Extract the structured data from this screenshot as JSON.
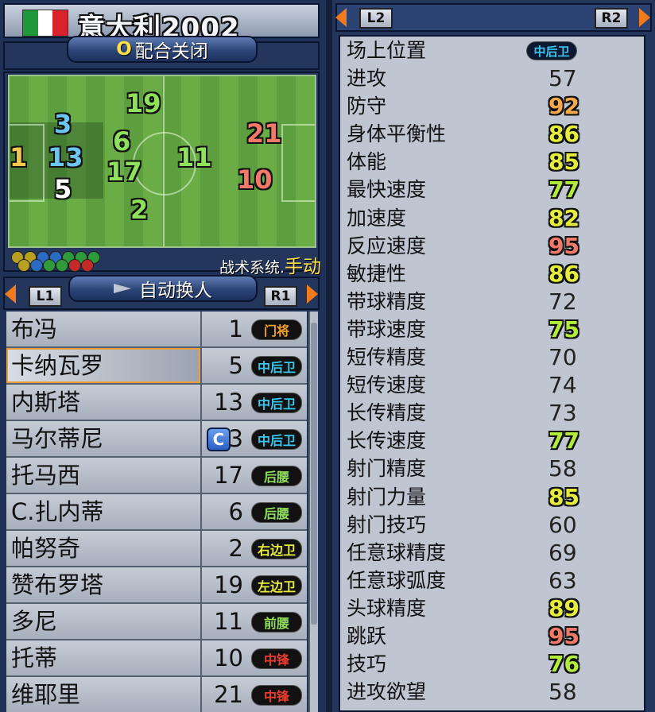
{
  "team": {
    "name": "意大利2002",
    "flag_colors": [
      "#1f9a3a",
      "#ffffff",
      "#d8232c"
    ]
  },
  "teamwork": {
    "key": "O",
    "label": "配合关闭"
  },
  "pitch": {
    "players": [
      {
        "num": "19",
        "color": "#8fe05a"
      },
      {
        "num": "3",
        "color": "#6cc6f0"
      },
      {
        "num": "21",
        "color": "#f2786a"
      },
      {
        "num": "6",
        "color": "#8fe05a"
      },
      {
        "num": "1",
        "color": "#f2c84a"
      },
      {
        "num": "13",
        "color": "#6cc6f0"
      },
      {
        "num": "11",
        "color": "#8fe05a"
      },
      {
        "num": "17",
        "color": "#8fe05a"
      },
      {
        "num": "10",
        "color": "#f2786a"
      },
      {
        "num": "5",
        "color": "#ffffff"
      },
      {
        "num": "2",
        "color": "#8fe05a"
      }
    ]
  },
  "tactics": {
    "label": "战术系统.",
    "mode": "手动"
  },
  "sub_bar": {
    "left_key": "L1",
    "label": "自动换人",
    "right_key": "R1"
  },
  "roster": [
    {
      "name": "布冯",
      "number": "1",
      "pos": "门将",
      "pos_color": "#f3a028"
    },
    {
      "name": "卡纳瓦罗",
      "number": "5",
      "pos": "中后卫",
      "pos_color": "#38c8f0"
    },
    {
      "name": "内斯塔",
      "number": "13",
      "pos": "中后卫",
      "pos_color": "#38c8f0"
    },
    {
      "name": "马尔蒂尼",
      "number": "3",
      "pos": "中后卫",
      "pos_color": "#38c8f0",
      "captain": "C"
    },
    {
      "name": "托马西",
      "number": "17",
      "pos": "后腰",
      "pos_color": "#8fe05a"
    },
    {
      "name": "C.扎内蒂",
      "number": "6",
      "pos": "后腰",
      "pos_color": "#8fe05a"
    },
    {
      "name": "帕努奇",
      "number": "2",
      "pos": "右边卫",
      "pos_color": "#e8ec3c"
    },
    {
      "name": "赞布罗塔",
      "number": "19",
      "pos": "左边卫",
      "pos_color": "#e8ec3c"
    },
    {
      "name": "多尼",
      "number": "11",
      "pos": "前腰",
      "pos_color": "#8fe05a"
    },
    {
      "name": "托蒂",
      "number": "10",
      "pos": "中锋",
      "pos_color": "#f03a2c"
    },
    {
      "name": "维耶里",
      "number": "21",
      "pos": "中锋",
      "pos_color": "#f03a2c"
    }
  ],
  "right_header": {
    "left_key": "L2",
    "right_key": "R2"
  },
  "stats": [
    {
      "label": "场上位置",
      "badge": "中后卫"
    },
    {
      "label": "进攻",
      "value": "57"
    },
    {
      "label": "防守",
      "value": "92",
      "color": "#f6a84a"
    },
    {
      "label": "身体平衡性",
      "value": "86",
      "color": "#e4ec3c"
    },
    {
      "label": "体能",
      "value": "85",
      "color": "#e4ec3c"
    },
    {
      "label": "最快速度",
      "value": "77",
      "color": "#b4ec3c"
    },
    {
      "label": "加速度",
      "value": "82",
      "color": "#e4ec3c"
    },
    {
      "label": "反应速度",
      "value": "95",
      "color": "#f07a6a"
    },
    {
      "label": "敏捷性",
      "value": "86",
      "color": "#e4ec3c"
    },
    {
      "label": "带球精度",
      "value": "72"
    },
    {
      "label": "带球速度",
      "value": "75",
      "color": "#b4ec3c"
    },
    {
      "label": "短传精度",
      "value": "70"
    },
    {
      "label": "短传速度",
      "value": "74"
    },
    {
      "label": "长传精度",
      "value": "73"
    },
    {
      "label": "长传速度",
      "value": "77",
      "color": "#b4ec3c"
    },
    {
      "label": "射门精度",
      "value": "58"
    },
    {
      "label": "射门力量",
      "value": "85",
      "color": "#e4ec3c"
    },
    {
      "label": "射门技巧",
      "value": "60"
    },
    {
      "label": "任意球精度",
      "value": "69"
    },
    {
      "label": "任意球弧度",
      "value": "63"
    },
    {
      "label": "头球精度",
      "value": "89",
      "color": "#e4ec3c"
    },
    {
      "label": "跳跃",
      "value": "95",
      "color": "#f07a6a"
    },
    {
      "label": "技巧",
      "value": "76",
      "color": "#b4ec3c"
    },
    {
      "label": "进攻欲望",
      "value": "58"
    }
  ]
}
